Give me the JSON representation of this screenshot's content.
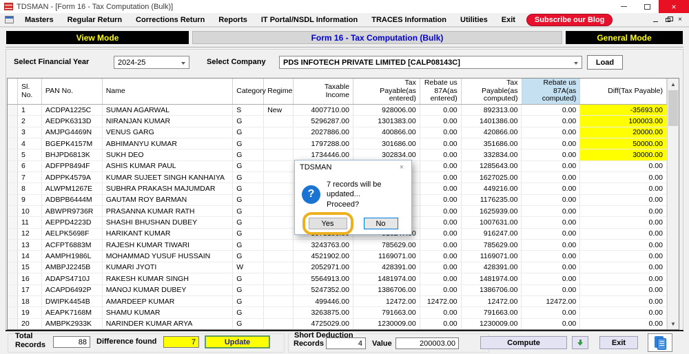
{
  "window": {
    "title": "TDSMAN - [Form 16 - Tax Computation (Bulk)]"
  },
  "menu": {
    "items": [
      "Masters",
      "Regular Return",
      "Corrections Return",
      "Reports",
      "IT Portal/NSDL Information",
      "TRACES Information",
      "Utilities",
      "Exit"
    ],
    "subscribe_label": "Subscribe our Blog"
  },
  "mode_bar": {
    "left": "View Mode",
    "center": "Form 16 - Tax Computation (Bulk)",
    "right": "General Mode"
  },
  "filters": {
    "fy_label": "Select Financial Year",
    "fy_value": "2024-25",
    "company_label": "Select Company",
    "company_value": "PDS INFOTECH PRIVATE LIMITED [CALP08143C]",
    "load_label": "Load"
  },
  "table": {
    "columns": [
      "Sl. No.",
      "PAN No.",
      "Name",
      "Category",
      "Regime",
      "Taxable\nIncome",
      "Tax\nPayable(as\nentered)",
      "Rebate us\n87A(as\nentered)",
      "Tax\nPayable(as\ncomputed)",
      "Rebate us\n87A(as\ncomputed)",
      "Diff(Tax Payable)"
    ],
    "rows": [
      [
        "1",
        "ACDPA1225C",
        "SUMAN AGARWAL",
        "S",
        "New",
        "4007710.00",
        "928006.00",
        "0.00",
        "892313.00",
        "0.00",
        "-35693.00"
      ],
      [
        "2",
        "AEDPK6313D",
        "NIRANJAN KUMAR",
        "G",
        "",
        "5296287.00",
        "1301383.00",
        "0.00",
        "1401386.00",
        "0.00",
        "100003.00"
      ],
      [
        "3",
        "AMJPG4469N",
        "VENUS GARG",
        "G",
        "",
        "2027886.00",
        "400866.00",
        "0.00",
        "420866.00",
        "0.00",
        "20000.00"
      ],
      [
        "4",
        "BGEPK4157M",
        "ABHIMANYU KUMAR",
        "G",
        "",
        "1797288.00",
        "301686.00",
        "0.00",
        "351686.00",
        "0.00",
        "50000.00"
      ],
      [
        "5",
        "BHJPD6813K",
        "SUKH DEO",
        "G",
        "",
        "1734446.00",
        "302834.00",
        "0.00",
        "332834.00",
        "0.00",
        "30000.00"
      ],
      [
        "6",
        "ADFPP8494F",
        "ASHIS KUMAR PAUL",
        "G",
        "",
        "",
        "",
        "0.00",
        "1285643.00",
        "0.00",
        "0.00"
      ],
      [
        "7",
        "ADPPK4579A",
        "KUMAR SUJEET SINGH KANHAIYA",
        "G",
        "",
        "",
        "",
        "0.00",
        "1627025.00",
        "0.00",
        "0.00"
      ],
      [
        "8",
        "ALWPM1267E",
        "SUBHRA PRAKASH MAJUMDAR",
        "G",
        "",
        "",
        "",
        "0.00",
        "449216.00",
        "0.00",
        "0.00"
      ],
      [
        "9",
        "ADBPB6444M",
        "GAUTAM ROY BARMAN",
        "G",
        "",
        "",
        "",
        "0.00",
        "1176235.00",
        "0.00",
        "0.00"
      ],
      [
        "10",
        "ABWPR9736R",
        "PRASANNA KUMAR RATH",
        "G",
        "",
        "",
        "",
        "0.00",
        "1625939.00",
        "0.00",
        "0.00"
      ],
      [
        "11",
        "AEPPD4223D",
        "SHASHI BHUSHAN DUBEY",
        "G",
        "",
        "",
        "",
        "0.00",
        "1007631.00",
        "0.00",
        "0.00"
      ],
      [
        "12",
        "AELPK5698F",
        "HARIKANT KUMAR",
        "G",
        "",
        "5975166.00",
        "916247.00",
        "0.00",
        "916247.00",
        "0.00",
        "0.00"
      ],
      [
        "13",
        "ACFPT6883M",
        "RAJESH KUMAR TIWARI",
        "G",
        "",
        "3243763.00",
        "785629.00",
        "0.00",
        "785629.00",
        "0.00",
        "0.00"
      ],
      [
        "14",
        "AAMPH1986L",
        "MOHAMMAD YUSUF HUSSAIN",
        "G",
        "",
        "4521902.00",
        "1169071.00",
        "0.00",
        "1169071.00",
        "0.00",
        "0.00"
      ],
      [
        "15",
        "AMBPJ2245B",
        "KUMARI JYOTI",
        "W",
        "",
        "2052971.00",
        "428391.00",
        "0.00",
        "428391.00",
        "0.00",
        "0.00"
      ],
      [
        "16",
        "ADAPS4710J",
        "RAKESH KUMAR SINGH",
        "G",
        "",
        "5564913.00",
        "1481974.00",
        "0.00",
        "1481974.00",
        "0.00",
        "0.00"
      ],
      [
        "17",
        "ACAPD6492P",
        "MANOJ KUMAR DUBEY",
        "G",
        "",
        "5247352.00",
        "1386706.00",
        "0.00",
        "1386706.00",
        "0.00",
        "0.00"
      ],
      [
        "18",
        "DWIPK4454B",
        "AMARDEEP KUMAR",
        "G",
        "",
        "499446.00",
        "12472.00",
        "12472.00",
        "12472.00",
        "12472.00",
        "0.00"
      ],
      [
        "19",
        "AEAPK7168M",
        "SHAMU KUMAR",
        "G",
        "",
        "3263875.00",
        "791663.00",
        "0.00",
        "791663.00",
        "0.00",
        "0.00"
      ],
      [
        "20",
        "AMBPK2933K",
        "NARINDER KUMAR ARYA",
        "G",
        "",
        "4725029.00",
        "1230009.00",
        "0.00",
        "1230009.00",
        "0.00",
        "0.00"
      ]
    ]
  },
  "dialog": {
    "title": "TDSMAN",
    "message_line1": "7 records will be updated...",
    "message_line2": "Proceed?",
    "question_mark": "?",
    "yes_label": "Yes",
    "no_label": "No"
  },
  "footer": {
    "total_records_label": "Total\nRecords",
    "total_records_value": "88",
    "difference_label": "Difference found",
    "difference_value": "7",
    "update_label": "Update",
    "short_deduction_label": "Short Deduction",
    "records_label": "Records",
    "records_value": "4",
    "value_label": "Value",
    "value_value": "200003.00",
    "compute_label": "Compute",
    "exit_label": "Exit"
  },
  "colors": {
    "highlight_yellow": "#ffff00",
    "header_blue": "#c5e0f0",
    "brand_red": "#e8112d",
    "mode_black": "#000000",
    "mode_yellow": "#ffff00",
    "title_blue": "#0000cd",
    "dialog_icon_blue": "#1b74d2",
    "focus_ring_orange": "#edb01f",
    "close_red": "#e81123"
  }
}
